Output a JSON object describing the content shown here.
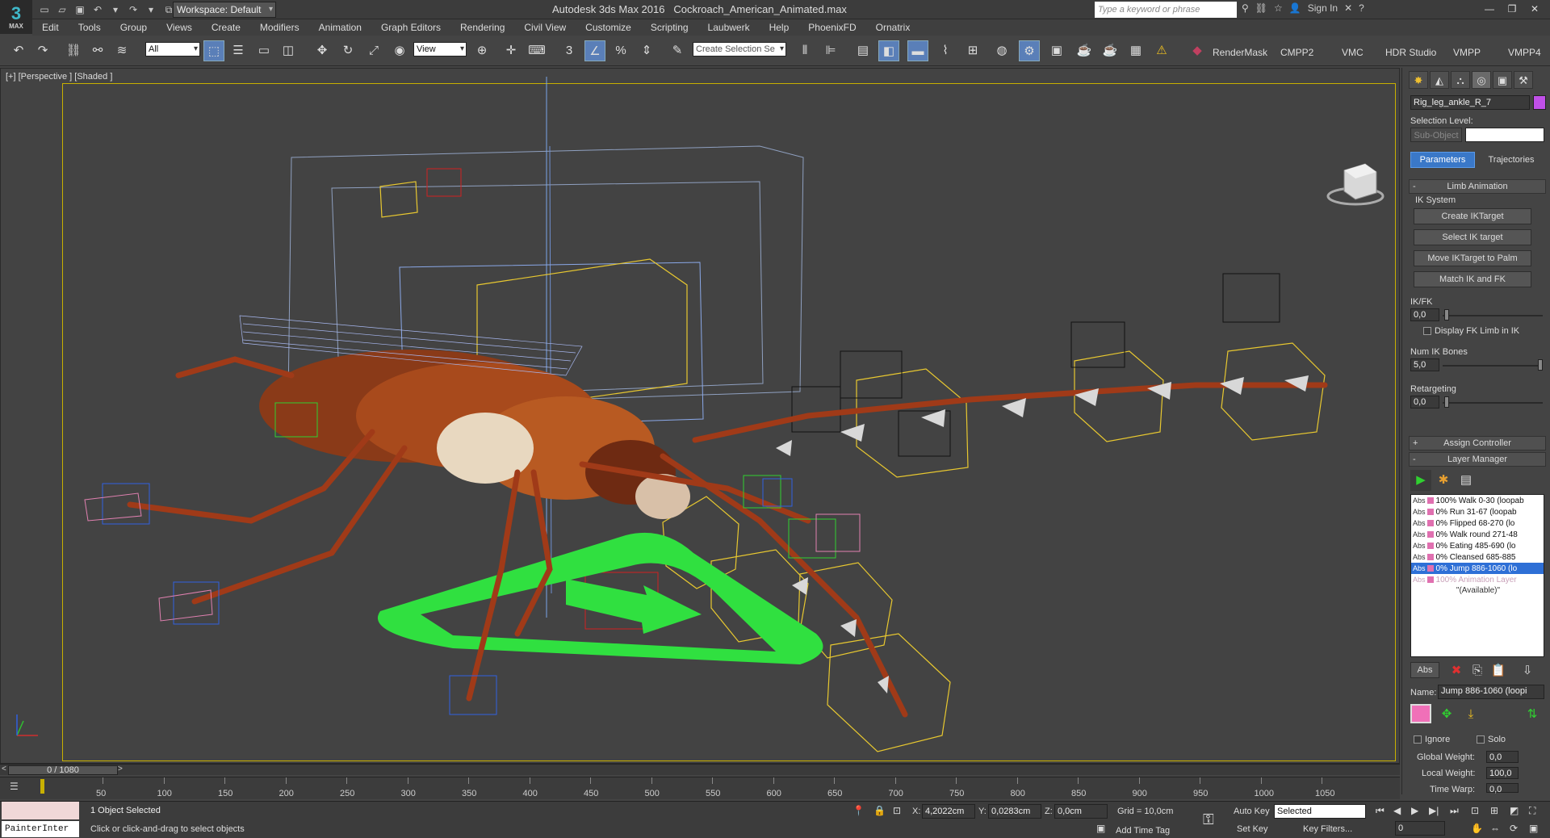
{
  "titlebar": {
    "app_title": "Autodesk 3ds Max 2016",
    "file_name": "Cockroach_American_Animated.max",
    "workspace_label": "Workspace: Default",
    "search_placeholder": "Type a keyword or phrase",
    "sign_in": "Sign In",
    "logo_text": "3",
    "logo_sub": "MAX"
  },
  "menu": [
    "Edit",
    "Tools",
    "Group",
    "Views",
    "Create",
    "Modifiers",
    "Animation",
    "Graph Editors",
    "Rendering",
    "Civil View",
    "Customize",
    "Scripting",
    "Laubwerk",
    "Help",
    "PhoenixFD",
    "Ornatrix"
  ],
  "toolbar": {
    "selection_filter": "All",
    "ref_coord": "View",
    "named_selection_placeholder": "Create Selection Se",
    "plugins": [
      "RenderMask",
      "CMPP2",
      "VMC",
      "HDR Studio",
      "VMPP",
      "VMPP4"
    ]
  },
  "viewport": {
    "label": "[+] [Perspective ] [Shaded ]"
  },
  "command_panel": {
    "object_name": "Rig_leg_ankle_R_7",
    "object_color": "#c050e8",
    "selection_level_label": "Selection Level:",
    "sub_object_label": "Sub-Object",
    "tab_parameters": "Parameters",
    "tab_trajectories": "Trajectories",
    "rollout_limb": "Limb Animation",
    "ik_system_label": "IK System",
    "btn_create_ik": "Create IKTarget",
    "btn_select_ik": "Select IK target",
    "btn_move_ik": "Move IKTarget to Palm",
    "btn_match": "Match IK and FK",
    "ikfk_label": "IK/FK",
    "ikfk_value": "0,0",
    "display_fk_label": "Display FK Limb in IK",
    "num_ik_label": "Num IK Bones",
    "num_ik_value": "5,0",
    "retargeting_label": "Retargeting",
    "retargeting_value": "0,0",
    "rollout_assign": "Assign Controller",
    "rollout_layer": "Layer Manager",
    "layers": [
      {
        "abs": "Abs",
        "text": "100% Walk 0-30 (loopab",
        "state": "normal"
      },
      {
        "abs": "Abs",
        "text": "0% Run 31-67 (loopab",
        "state": "normal"
      },
      {
        "abs": "Abs",
        "text": "0% Flipped 68-270 (lo",
        "state": "normal"
      },
      {
        "abs": "Abs",
        "text": "0% Walk round 271-48",
        "state": "normal"
      },
      {
        "abs": "Abs",
        "text": "0% Eating 485-690 (lo",
        "state": "normal"
      },
      {
        "abs": "Abs",
        "text": "0% Cleansed 685-885",
        "state": "normal"
      },
      {
        "abs": "Abs",
        "text": "0% Jump 886-1060 (lo",
        "state": "selected"
      },
      {
        "abs": "Abs",
        "text": "100% Animation Layer",
        "state": "dim"
      },
      {
        "abs": "",
        "text": "\"(Available)\"",
        "state": "center"
      }
    ],
    "layer_name_label": "Name:",
    "layer_name_value": "Jump 886-1060 (loopi",
    "ignore_label": "Ignore",
    "solo_label": "Solo",
    "global_weight_label": "Global Weight:",
    "global_weight_value": "0,0",
    "local_weight_label": "Local Weight:",
    "local_weight_value": "100,0",
    "time_warp_label": "Time Warp:",
    "time_warp_value": "0,0",
    "abs_button": "Abs"
  },
  "timeline": {
    "frame_display": "0 / 1080",
    "ticks": [
      "50",
      "100",
      "150",
      "200",
      "250",
      "300",
      "350",
      "400",
      "450",
      "500",
      "550",
      "600",
      "650",
      "700",
      "750",
      "800",
      "850",
      "900",
      "950",
      "1000",
      "1050"
    ]
  },
  "status": {
    "maxscript_text": "PainterInter",
    "selected_text": "1 Object Selected",
    "prompt_text": "Click or click-and-drag to select objects",
    "x_label": "X:",
    "x_value": "4,2022cm",
    "y_label": "Y:",
    "y_value": "0,0283cm",
    "z_label": "Z:",
    "z_value": "0,0cm",
    "grid_text": "Grid = 10,0cm",
    "add_time_tag": "Add Time Tag",
    "auto_key": "Auto Key",
    "set_key": "Set Key",
    "selected_dropdown": "Selected",
    "key_filters": "Key Filters...",
    "frame_value": "0"
  }
}
